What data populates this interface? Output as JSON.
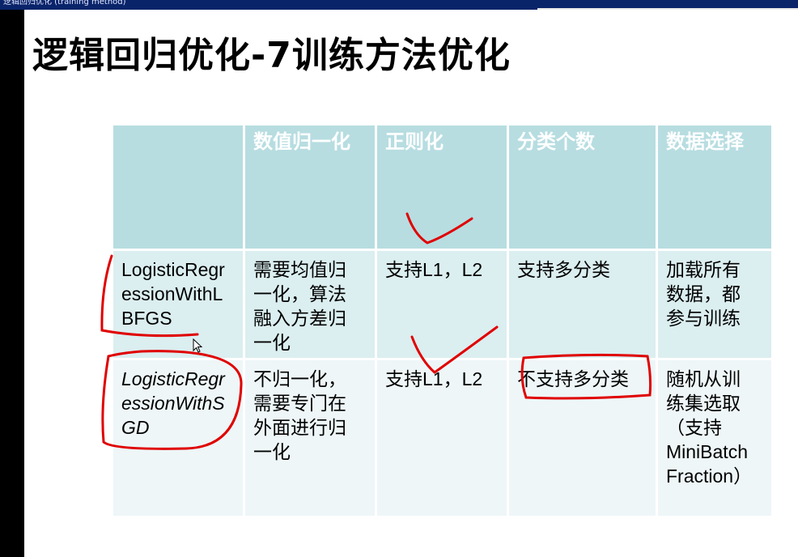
{
  "window": {
    "title_fragment": "逻辑回归优化 (training method)"
  },
  "slide": {
    "title": "逻辑回归优化-7训练方法优化",
    "table": {
      "headers": [
        "",
        "数值归一化",
        "正则化",
        "分类个数",
        "数据选择"
      ],
      "rows": [
        {
          "name": "LogisticRegressionWithLBFGS",
          "name_lines": [
            "LogisticRegr",
            "essionWithL",
            "BFGS"
          ],
          "normalization_lines": [
            "需要均值归",
            "一化，算法",
            "融入方差归",
            "一化"
          ],
          "regularization_lines": [
            "支持L1，L2"
          ],
          "classes_lines": [
            "支持多分类"
          ],
          "data_selection_lines": [
            "加载所有",
            "数据，都",
            "参与训练"
          ]
        },
        {
          "name": "LogisticRegressionWithSGD",
          "name_lines": [
            "LogisticRegr",
            "essionWithS",
            "GD"
          ],
          "normalization_lines": [
            "不归一化，",
            "需要专门在",
            "外面进行归",
            "一化"
          ],
          "regularization_lines": [
            "支持L1，L2"
          ],
          "classes_lines": [
            "不支持多分类"
          ],
          "data_selection_lines": [
            "随机从训",
            "练集选取",
            "（支持",
            "MiniBatch",
            "Fraction）"
          ]
        }
      ]
    },
    "colors": {
      "header_bg": "#b7dde1",
      "row1_bg": "#dbeef0",
      "row2_bg": "#eef6f8",
      "annotation": "#e00000"
    }
  }
}
